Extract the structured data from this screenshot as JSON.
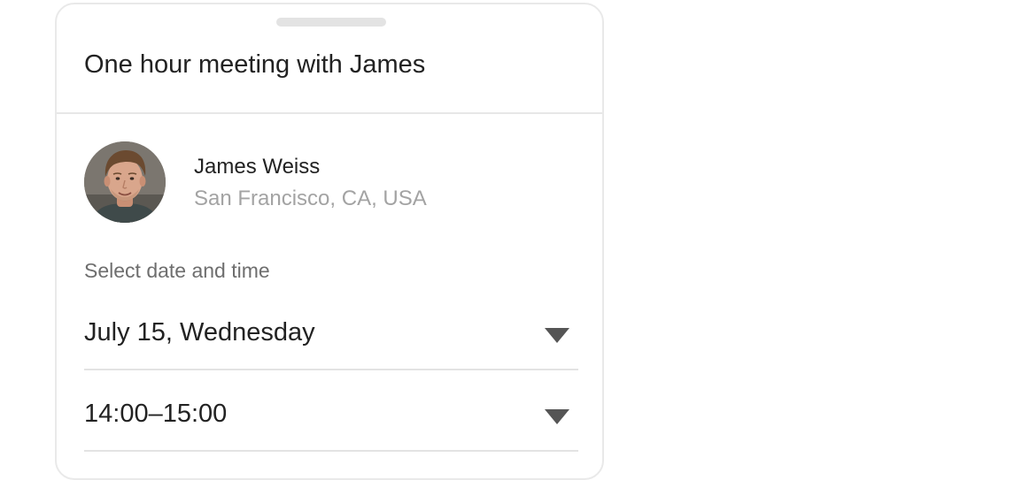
{
  "booking": {
    "title": "One hour meeting with James",
    "host": {
      "name": "James Weiss",
      "location": "San Francisco, CA, USA",
      "avatar_icon": "person-photo"
    },
    "date_time_label": "Select date and time",
    "date_select": {
      "value": "July 15, Wednesday",
      "icon": "caret-down"
    },
    "time_select": {
      "value": "14:00–15:00",
      "icon": "caret-down"
    }
  },
  "colors": {
    "text_primary": "#222222",
    "text_secondary": "#a3a3a3",
    "label": "#6e6e6e",
    "divider": "#e7e7e7",
    "caret": "#555555"
  }
}
